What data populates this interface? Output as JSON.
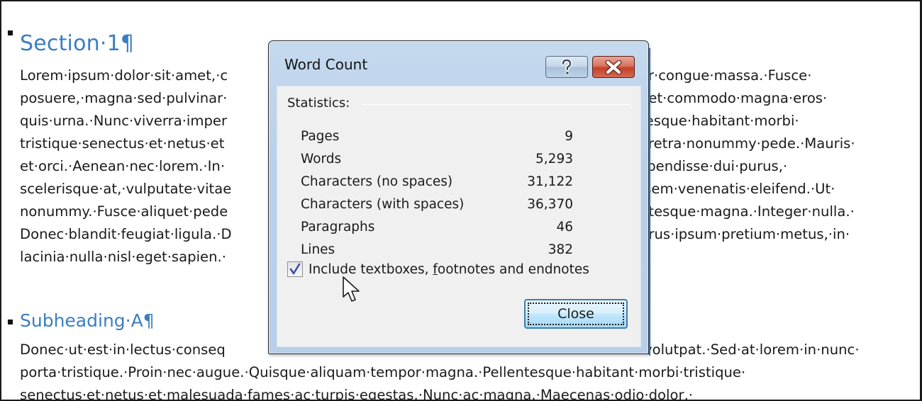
{
  "document": {
    "section_heading": "Section·1¶",
    "section_paragraph_lines": [
      {
        "left": "Lorem·ipsum·dolor·sit·amet,·c",
        "right": "or·congue·massa.·Fusce·"
      },
      {
        "left": "posuere,·magna·sed·pulvinar·",
        "right": "net·commodo·magna·eros·"
      },
      {
        "left": "quis·urna.·Nunc·viverra·imper",
        "right": "tesque·habitant·morbi·"
      },
      {
        "left": "tristique·senectus·et·netus·et",
        "right": "aretra·nonummy·pede.·Mauris·"
      },
      {
        "left": "et·orci.·Aenean·nec·lorem.·In·",
        "right": "spendisse·dui·purus,·"
      },
      {
        "left": "scelerisque·at,·vulputate·vitae",
        "right": "·sem·venenatis·eleifend.·Ut·"
      },
      {
        "left": "nonummy.·Fusce·aliquet·pede",
        "right": "ntesque·magna.·Integer·nulla.·"
      },
      {
        "left": "Donec·blandit·feugiat·ligula.·D",
        "right": "urus·ipsum·pretium·metus,·in·"
      },
      {
        "left": "lacinia·nulla·nisl·eget·sapien.·",
        "right": ""
      }
    ],
    "subheading": "Subheading·A¶",
    "subheading_paragraph_lines": [
      {
        "left": "Donec·ut·est·in·lectus·conseq",
        "right": "volutpat.·Sed·at·lorem·in·nunc·"
      },
      {
        "left": "porta·tristique.·Proin·nec·augue.·Quisque·aliquam·tempor·magna.·Pellentesque·habitant·morbi·tristique·",
        "right": ""
      },
      {
        "left": "senectus·et·netus·et·malesuada·fames·ac·turpis·egestas.·Nunc·ac·magna.·Maecenas·odio·dolor,·",
        "right": ""
      }
    ]
  },
  "dialog": {
    "title": "Word Count",
    "help_button_icon": "question-mark-icon",
    "close_button_icon": "close-x-icon",
    "group_label": "Statistics:",
    "stats": [
      {
        "label": "Pages",
        "value": "9"
      },
      {
        "label": "Words",
        "value": "5,293"
      },
      {
        "label": "Characters (no spaces)",
        "value": "31,122"
      },
      {
        "label": "Characters (with spaces)",
        "value": "36,370"
      },
      {
        "label": "Paragraphs",
        "value": "46"
      },
      {
        "label": "Lines",
        "value": "382"
      }
    ],
    "checkbox": {
      "label_before": "Include textboxes, ",
      "label_underlined": "f",
      "label_after": "ootnotes and endnotes",
      "checked": true
    },
    "close_button_label": "Close"
  },
  "colors": {
    "heading": "#3b7ec0",
    "dialog_frame": "#b8d0ea",
    "close_x_red": "#c4402a",
    "button_blue": "#bee6fd"
  }
}
